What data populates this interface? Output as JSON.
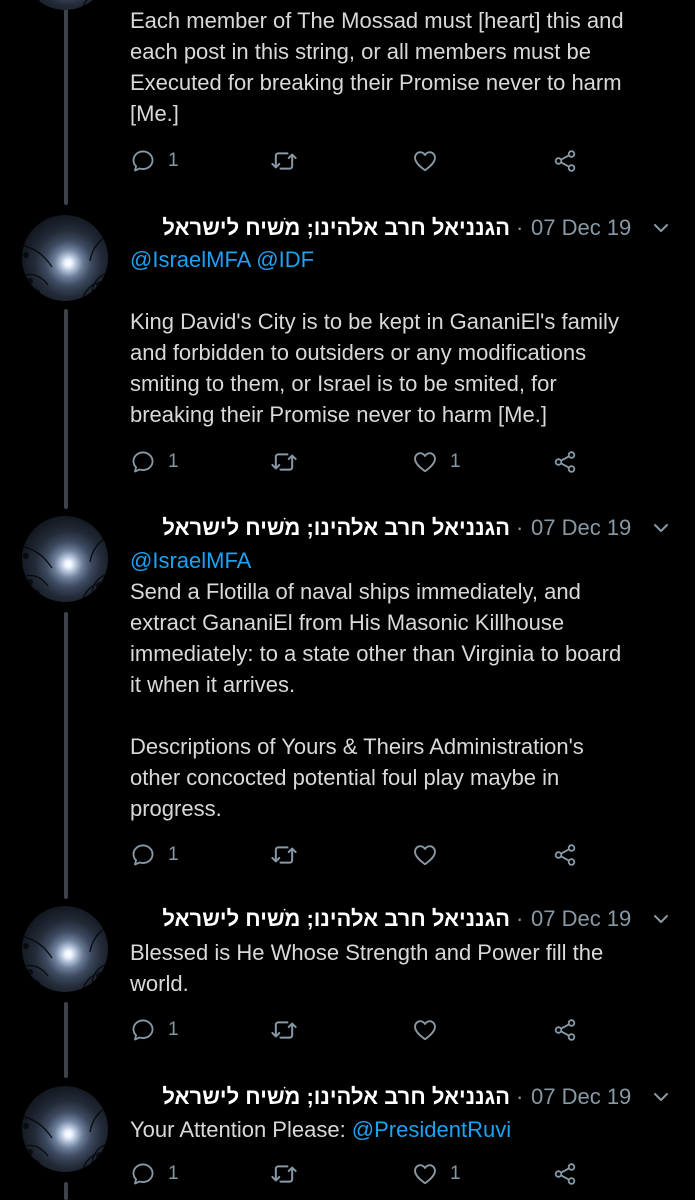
{
  "colors": {
    "background": "#000000",
    "text": "#d9d9d9",
    "name": "#ffffff",
    "muted": "#8899a6",
    "link": "#1da1f2",
    "thread_line": "#3d4349"
  },
  "icons": {
    "reply": "reply-icon",
    "retweet": "retweet-icon",
    "like": "heart-icon",
    "share": "share-icon",
    "menu": "chevron-down-icon"
  },
  "tweets": [
    {
      "text_lines": [
        "Each member of The Mossad must [heart] this and",
        "each post in this string, or all members must be",
        "Executed for breaking their Promise never to harm",
        "[Me.]"
      ],
      "reply_count": "1",
      "retweet_count": "",
      "like_count": ""
    },
    {
      "display_name": "הגנניאל חרב אלהינו; מֹשיח לישראל",
      "separator": "·",
      "date": "07 Dec 19",
      "mention_1": "@IsraelMFA",
      "mention_2": "@IDF",
      "text_lines": [
        "King David's City is to be kept in GananiEl's family",
        "and forbidden to outsiders or any modifications",
        "smiting to them, or Israel is to be smited, for",
        "breaking their Promise never to harm [Me.]"
      ],
      "reply_count": "1",
      "retweet_count": "",
      "like_count": "1"
    },
    {
      "display_name": "הגנניאל חרב אלהינו; מֹשיח לישראל",
      "separator": "·",
      "date": "07 Dec 19",
      "mention_1": "@IsraelMFA",
      "para1_lines": [
        "Send a Flotilla of naval ships immediately, and",
        "extract GananiEl from His Masonic Killhouse",
        "immediately: to a state other than Virginia to board",
        "it when it arrives."
      ],
      "para2_lines": [
        "Descriptions of Yours & Theirs Administration's",
        "other concocted potential foul play maybe in",
        "progress."
      ],
      "reply_count": "1",
      "retweet_count": "",
      "like_count": ""
    },
    {
      "display_name": "הגנניאל חרב אלהינו; מֹשיח לישראל",
      "separator": "·",
      "date": "07 Dec 19",
      "text_lines": [
        "Blessed is He Whose Strength and Power fill the",
        "world."
      ],
      "reply_count": "1",
      "retweet_count": "",
      "like_count": ""
    },
    {
      "display_name": "הגנניאל חרב אלהינו; מֹשיח לישראל",
      "separator": "·",
      "date": "07 Dec 19",
      "text_prefix": "Your Attention Please: ",
      "mention_1": "@PresidentRuvi",
      "reply_count": "1",
      "retweet_count": "",
      "like_count": "1"
    }
  ]
}
